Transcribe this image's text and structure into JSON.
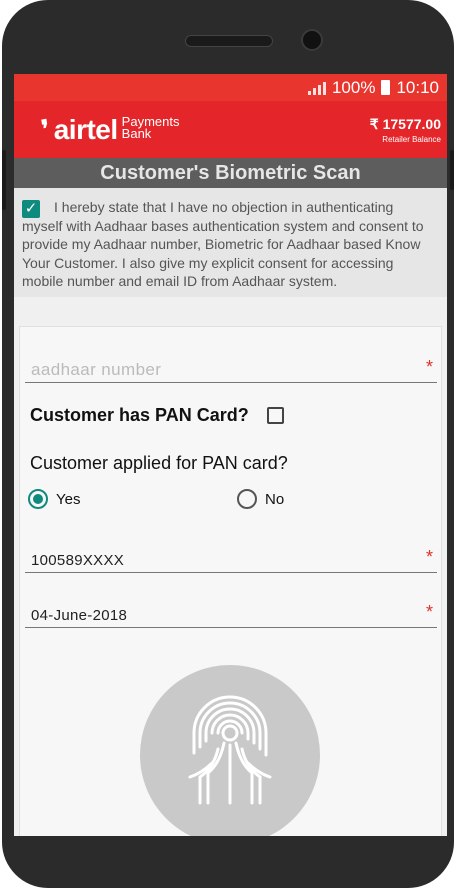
{
  "statusbar": {
    "battery": "100%",
    "time": "10:10"
  },
  "header": {
    "logo_word": "airtel",
    "logo_sub_1": "Payments",
    "logo_sub_2": "Bank",
    "balance_amount": "₹ 17577.00",
    "balance_label": "Retailer Balance"
  },
  "title": "Customer's Biometric Scan",
  "consent": {
    "checked": true,
    "text_line1": "I hereby state that I have no objection in authenticating",
    "text_rest": "myself with Aadhaar bases authentication system and consent to provide my Aadhaar number, Biometric for Aadhaar based Know Your Customer. I also give my explicit consent for accessing mobile number and email ID from Aadhaar system."
  },
  "form": {
    "aadhaar_placeholder": "aadhaar number",
    "required_mark": "*",
    "pan_label": "Customer has PAN Card?",
    "applied_label": "Customer applied for PAN card?",
    "yes_label": "Yes",
    "no_label": "No",
    "selected": "Yes",
    "number_value": "100589XXXX",
    "date_value": "04-June-2018"
  },
  "colors": {
    "brand_red": "#e4262a",
    "accent_teal": "#0e8a7f"
  }
}
